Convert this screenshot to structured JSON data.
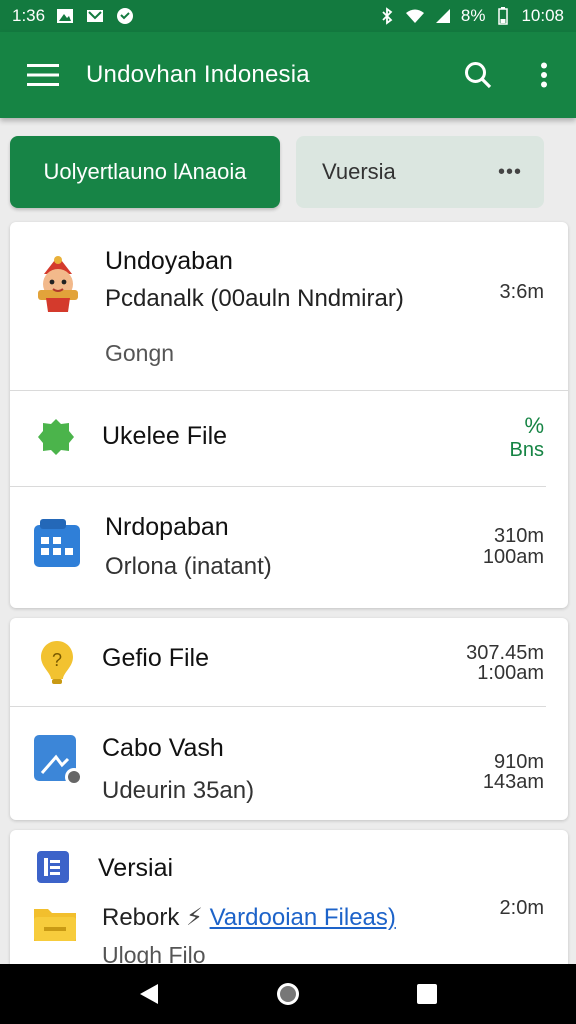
{
  "status": {
    "time": "1:36",
    "battery": "8%",
    "clock": "10:08"
  },
  "appbar": {
    "title": "Undovhan Indonesia"
  },
  "tabs": [
    {
      "label": "Uolyertlauno lAnaoia",
      "active": true
    },
    {
      "label": "Vuersia",
      "active": false
    }
  ],
  "items": [
    {
      "title": "Undoyaban",
      "subtitle": "Pcdanalk (00auln Nndmirar)",
      "meta": "Gongn",
      "time": "3:6m"
    },
    {
      "title": "Ukelee File",
      "time_top": "%",
      "time_bottom": "Bns"
    },
    {
      "title": "Nrdopaban",
      "subtitle": "Orlona (inatant)",
      "time_top": "310m",
      "time_bottom": "100am"
    },
    {
      "title": "Gefio File",
      "time_top": "307.45m",
      "time_bottom": "1:00am"
    },
    {
      "title": "Cabo Vash",
      "subtitle": "Udeurin 35an)",
      "time_top": "910m",
      "time_bottom": "143am"
    },
    {
      "title": "Versiai",
      "subtitle_prefix": "Rebork",
      "link_text": "Vardooian Fileas)",
      "meta": "Ulogh Filo",
      "time": "2:0m"
    }
  ],
  "colors": {
    "primary": "#168444",
    "accent": "#178446",
    "link": "#1d63c9"
  }
}
